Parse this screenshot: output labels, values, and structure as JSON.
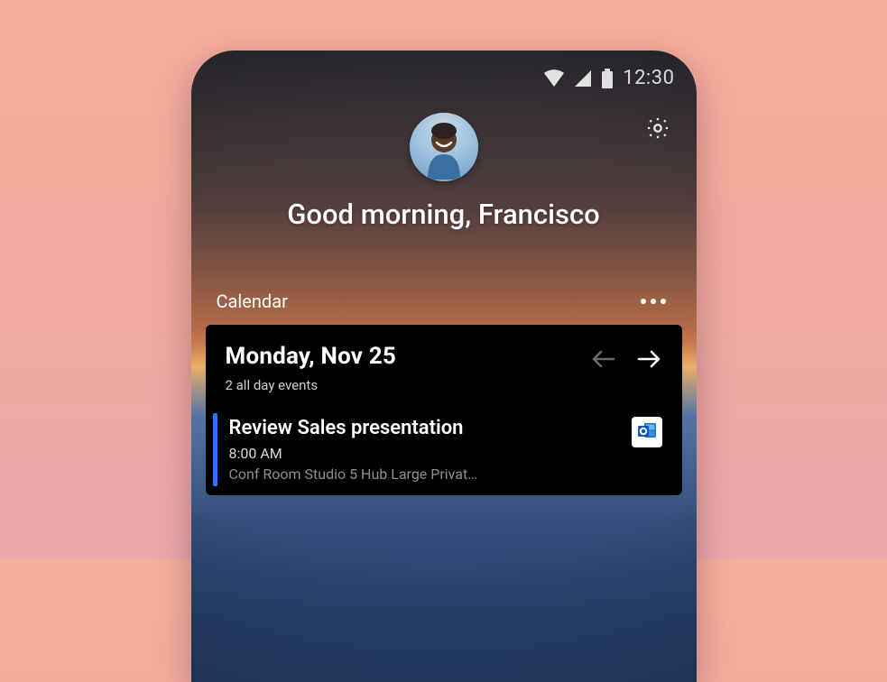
{
  "status": {
    "time": "12:30"
  },
  "header": {
    "greeting": "Good morning, Francisco"
  },
  "section": {
    "title": "Calendar"
  },
  "calendar": {
    "date_title": "Monday, Nov 25",
    "date_subtitle": "2 all day events",
    "event": {
      "title": "Review Sales presentation",
      "time": "8:00 AM",
      "location": "Conf Room Studio 5 Hub Large Privat…",
      "app": "outlook"
    }
  },
  "colors": {
    "accent": "#2f74ff"
  }
}
